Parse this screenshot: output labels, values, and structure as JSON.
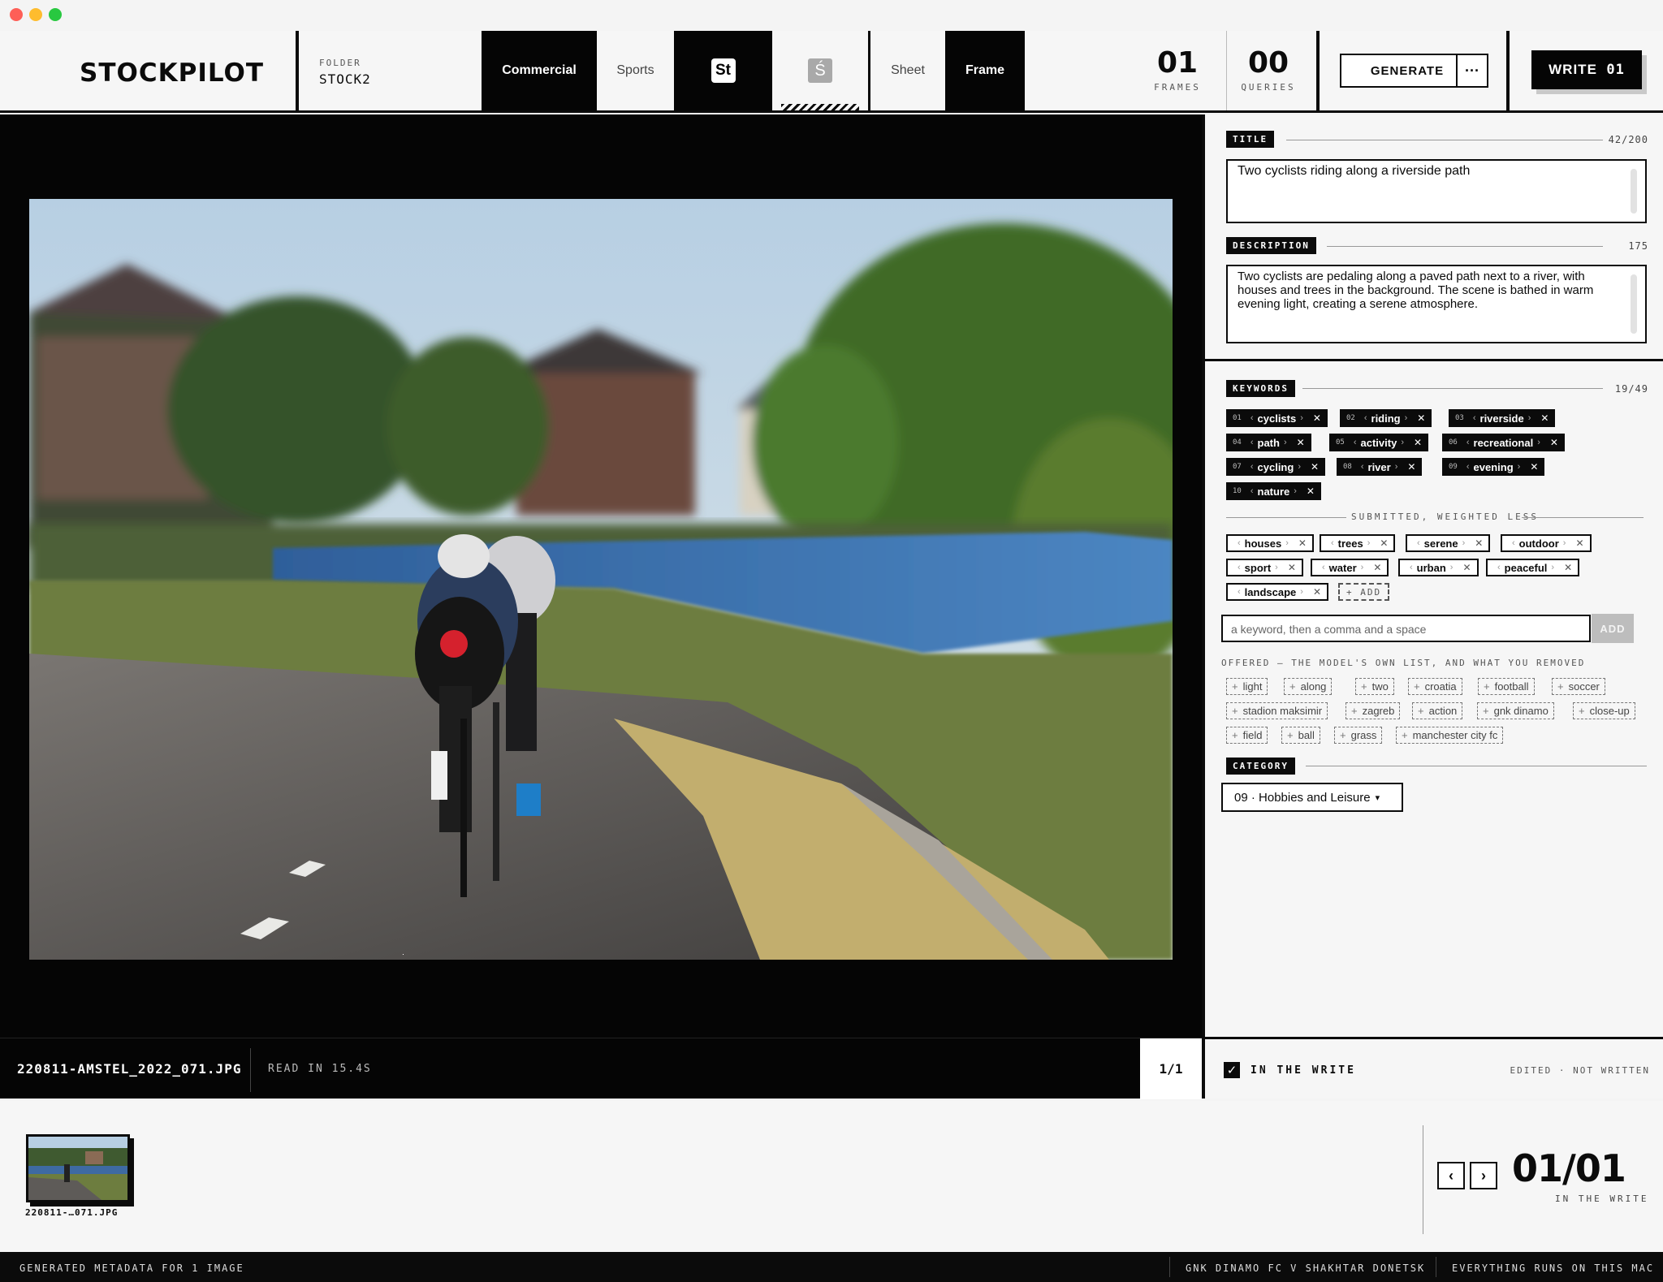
{
  "app": {
    "name": "STOCKPILOT"
  },
  "folder": {
    "label": "FOLDER",
    "value": "STOCK2"
  },
  "tabs": [
    {
      "label": "Commercial"
    },
    {
      "label": "Sports"
    },
    {
      "label": "St"
    },
    {
      "label": "Ś"
    },
    {
      "label": "Sheet"
    },
    {
      "label": "Frame"
    }
  ],
  "counters": {
    "frames": {
      "value": "01",
      "label": "FRAMES"
    },
    "queries": {
      "value": "00",
      "label": "QUERIES"
    }
  },
  "actions": {
    "generate": "GENERATE",
    "more": "···",
    "write": "WRITE",
    "write_count": "01"
  },
  "viewer": {
    "filename": "220811-AMSTEL_2022_071.JPG",
    "read_time": "READ IN 15.4S",
    "pager": "1/1"
  },
  "title": {
    "label": "TITLE",
    "count": "42/200",
    "value": "Two cyclists riding along a riverside path"
  },
  "description": {
    "label": "DESCRIPTION",
    "count": "175",
    "value": "Two cyclists are pedaling along a paved path next to a river, with houses and trees in the background. The scene is bathed in warm evening light, creating a serene atmosphere."
  },
  "keywords": {
    "label": "KEYWORDS",
    "count": "19/49",
    "primary": [
      {
        "num": "01",
        "text": "cyclists"
      },
      {
        "num": "02",
        "text": "riding"
      },
      {
        "num": "03",
        "text": "riverside"
      },
      {
        "num": "04",
        "text": "path"
      },
      {
        "num": "05",
        "text": "activity"
      },
      {
        "num": "06",
        "text": "recreational"
      },
      {
        "num": "07",
        "text": "cycling"
      },
      {
        "num": "08",
        "text": "river"
      },
      {
        "num": "09",
        "text": "evening"
      },
      {
        "num": "10",
        "text": "nature"
      }
    ],
    "secondary_label": "SUBMITTED, WEIGHTED LESS",
    "secondary": [
      "houses",
      "trees",
      "serene",
      "outdoor",
      "sport",
      "water",
      "urban",
      "peaceful",
      "landscape"
    ],
    "add_chip": "+ ADD",
    "input_placeholder": "a keyword, then a comma and a space",
    "add_button": "ADD"
  },
  "offered": {
    "label": "OFFERED — THE MODEL'S OWN LIST, AND WHAT YOU REMOVED",
    "items": [
      "light",
      "along",
      "two",
      "croatia",
      "football",
      "soccer",
      "stadion maksimir",
      "zagreb",
      "action",
      "gnk dinamo",
      "close-up",
      "field",
      "ball",
      "grass",
      "manchester city fc"
    ]
  },
  "category": {
    "label": "CATEGORY",
    "value": "09 · Hobbies and Leisure"
  },
  "panel_footer": {
    "in_write": "IN THE WRITE",
    "status": "EDITED · NOT WRITTEN"
  },
  "filmstrip": {
    "thumb_name": "220811-…071.JPG",
    "count": "01/01",
    "count_label": "IN THE WRITE"
  },
  "statusbar": {
    "left": "GENERATED METADATA FOR 1 IMAGE",
    "middle": "GNK DINAMO FC V SHAKHTAR DONETSK",
    "right": "EVERYTHING RUNS ON THIS MAC"
  },
  "icons": {
    "checkbox": "check-icon",
    "prev": "chevron-left-icon",
    "next": "chevron-right-icon",
    "category_caret": "chevron-down-icon"
  }
}
